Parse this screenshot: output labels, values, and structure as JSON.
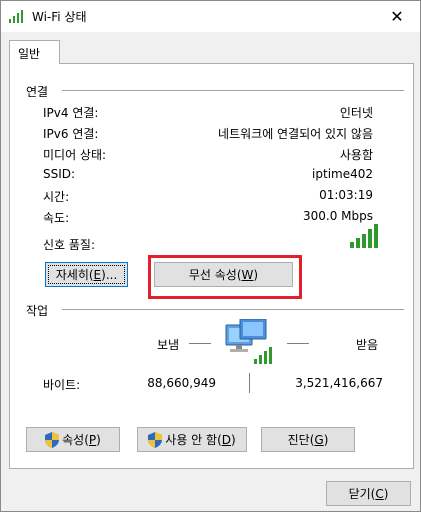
{
  "window": {
    "title": "Wi-Fi 상태",
    "close_glyph": "✕"
  },
  "tab": {
    "label": "일반"
  },
  "connection": {
    "heading": "연결",
    "rows": [
      {
        "label": "IPv4 연결:",
        "value": "인터넷"
      },
      {
        "label": "IPv6 연결:",
        "value": "네트워크에 연결되어 있지 않음"
      },
      {
        "label": "미디어 상태:",
        "value": "사용함"
      },
      {
        "label": "SSID:",
        "value": "iptime402"
      },
      {
        "label": "시간:",
        "value": "01:03:19"
      },
      {
        "label": "속도:",
        "value": "300.0 Mbps"
      }
    ],
    "signal_label": "신호 품질:",
    "signal_bars": 5,
    "details_button": {
      "text": "자세히(",
      "key": "E",
      "tail": ")..."
    },
    "wireless_button": {
      "text": "무선 속성(",
      "key": "W",
      "tail": ")"
    }
  },
  "activity": {
    "heading": "작업",
    "sent_label": "보냄",
    "received_label": "받음",
    "bytes_label": "바이트:",
    "bytes_sent": "88,660,949",
    "bytes_received": "3,521,416,667"
  },
  "actions": {
    "properties": {
      "text": "속성(",
      "key": "P",
      "tail": ")"
    },
    "disable": {
      "text": "사용 안 함(",
      "key": "D",
      "tail": ")"
    },
    "diagnose": {
      "text": "진단(",
      "key": "G",
      "tail": ")"
    }
  },
  "footer": {
    "close": {
      "text": "닫기(",
      "key": "C",
      "tail": ")"
    }
  },
  "colors": {
    "highlight": "#e3202a",
    "signal": "#2e9a2e",
    "accent": "#0078d7"
  }
}
